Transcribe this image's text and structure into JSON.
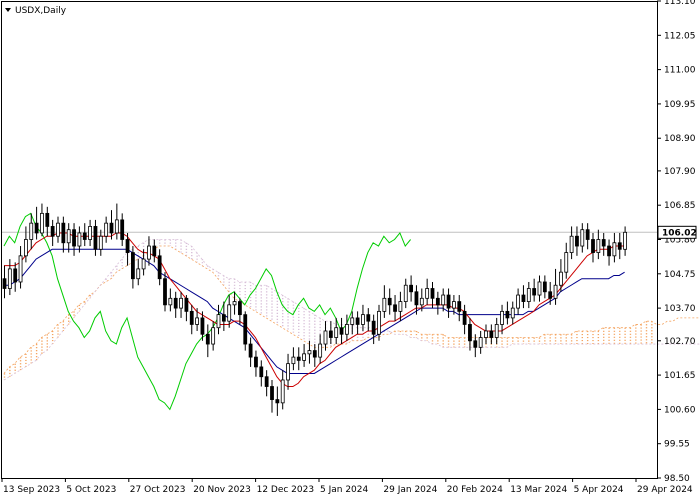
{
  "chart_data": {
    "type": "candlestick",
    "title": "USDX,Daily",
    "indicator": "Ichimoku Kinko Hyo",
    "ylim": [
      98.5,
      113.1
    ],
    "y_ticks": [
      "113.10",
      "112.05",
      "111.00",
      "109.95",
      "108.90",
      "107.90",
      "106.85",
      "105.80",
      "104.75",
      "103.70",
      "102.70",
      "101.65",
      "100.60",
      "99.55",
      "98.50"
    ],
    "x_ticks": [
      "13 Sep 2023",
      "5 Oct 2023",
      "27 Oct 2023",
      "20 Nov 2023",
      "12 Dec 2023",
      "5 Jan 2024",
      "29 Jan 2024",
      "20 Feb 2024",
      "13 Mar 2024",
      "5 Apr 2024",
      "29 Apr 2024"
    ],
    "last_price": "106.02",
    "last_price_value": 106.02,
    "colors": {
      "tenkan": "#cc0000",
      "kijun": "#00008b",
      "chikou": "#00cc00",
      "kumo_bull": "#f4a460",
      "kumo_bear": "#d8bfd8",
      "candle_body": "#000000",
      "axis": "#000000",
      "price_line": "#c0c0c0"
    },
    "ohlc": [
      [
        104.6,
        104.3,
        105.0,
        104.0
      ],
      [
        104.3,
        104.9,
        105.2,
        104.1
      ],
      [
        104.9,
        104.5,
        105.1,
        104.2
      ],
      [
        104.5,
        105.3,
        105.6,
        104.3
      ],
      [
        105.3,
        105.8,
        106.2,
        105.1
      ],
      [
        105.8,
        106.3,
        106.6,
        105.5
      ],
      [
        106.3,
        106.0,
        106.8,
        105.8
      ],
      [
        106.0,
        106.6,
        106.9,
        105.9
      ],
      [
        106.6,
        106.2,
        106.8,
        105.9
      ],
      [
        106.2,
        105.9,
        106.4,
        105.6
      ],
      [
        105.9,
        106.3,
        106.5,
        105.7
      ],
      [
        106.3,
        105.7,
        106.5,
        105.4
      ],
      [
        105.7,
        106.1,
        106.3,
        105.4
      ],
      [
        106.1,
        105.6,
        106.3,
        105.3
      ],
      [
        105.6,
        106.0,
        106.2,
        105.4
      ],
      [
        106.0,
        105.8,
        106.3,
        105.6
      ],
      [
        105.8,
        106.2,
        106.4,
        105.6
      ],
      [
        106.2,
        105.5,
        106.4,
        105.3
      ],
      [
        105.5,
        105.9,
        106.1,
        105.3
      ],
      [
        105.9,
        106.3,
        106.5,
        105.7
      ],
      [
        106.3,
        106.0,
        106.7,
        105.8
      ],
      [
        106.0,
        106.4,
        106.9,
        105.8
      ],
      [
        106.4,
        105.8,
        106.6,
        105.6
      ],
      [
        105.8,
        105.4,
        106.0,
        105.0
      ],
      [
        105.4,
        104.6,
        105.6,
        104.3
      ],
      [
        104.6,
        104.9,
        105.2,
        104.4
      ],
      [
        104.9,
        105.2,
        105.5,
        104.7
      ],
      [
        105.2,
        105.6,
        105.9,
        105.0
      ],
      [
        105.6,
        105.3,
        105.8,
        105.1
      ],
      [
        105.3,
        104.6,
        105.5,
        104.4
      ],
      [
        104.6,
        103.8,
        104.8,
        103.6
      ],
      [
        103.8,
        104.0,
        104.3,
        103.6
      ],
      [
        104.0,
        103.7,
        104.2,
        103.4
      ],
      [
        103.7,
        104.0,
        104.2,
        103.4
      ],
      [
        104.0,
        103.6,
        104.1,
        103.3
      ],
      [
        103.6,
        103.2,
        103.8,
        102.9
      ],
      [
        103.2,
        103.4,
        103.7,
        103.0
      ],
      [
        103.4,
        102.9,
        103.6,
        102.7
      ],
      [
        102.9,
        102.6,
        103.2,
        102.2
      ],
      [
        102.6,
        103.1,
        103.3,
        102.4
      ],
      [
        103.1,
        103.5,
        103.8,
        102.9
      ],
      [
        103.5,
        103.3,
        103.9,
        103.0
      ],
      [
        103.3,
        103.8,
        104.1,
        103.1
      ],
      [
        103.8,
        103.9,
        104.2,
        103.5
      ],
      [
        103.9,
        103.5,
        104.0,
        103.2
      ],
      [
        103.5,
        102.6,
        103.6,
        102.4
      ],
      [
        102.6,
        102.2,
        102.8,
        101.9
      ],
      [
        102.2,
        101.9,
        102.4,
        101.6
      ],
      [
        101.9,
        101.6,
        102.1,
        101.3
      ],
      [
        101.6,
        101.3,
        101.8,
        101.0
      ],
      [
        101.3,
        100.9,
        101.5,
        100.5
      ],
      [
        100.9,
        100.8,
        101.3,
        100.4
      ],
      [
        100.8,
        101.5,
        101.8,
        100.6
      ],
      [
        101.5,
        102.0,
        102.3,
        101.2
      ],
      [
        102.0,
        102.2,
        102.5,
        101.8
      ],
      [
        102.2,
        102.1,
        102.5,
        101.8
      ],
      [
        102.1,
        102.3,
        102.6,
        101.9
      ],
      [
        102.3,
        102.4,
        102.7,
        102.0
      ],
      [
        102.4,
        102.2,
        102.6,
        101.9
      ],
      [
        102.2,
        102.6,
        102.9,
        102.0
      ],
      [
        102.6,
        103.0,
        103.3,
        102.4
      ],
      [
        103.0,
        102.8,
        103.3,
        102.6
      ],
      [
        102.8,
        103.1,
        103.4,
        102.6
      ],
      [
        103.1,
        102.9,
        103.4,
        102.6
      ],
      [
        102.9,
        103.2,
        103.5,
        102.7
      ],
      [
        103.2,
        103.4,
        103.6,
        102.9
      ],
      [
        103.4,
        103.2,
        103.6,
        102.9
      ],
      [
        103.2,
        103.5,
        103.8,
        103.0
      ],
      [
        103.5,
        103.3,
        103.7,
        103.0
      ],
      [
        103.3,
        102.9,
        103.5,
        102.6
      ],
      [
        102.9,
        103.6,
        103.8,
        102.7
      ],
      [
        103.6,
        104.0,
        104.4,
        103.4
      ],
      [
        104.0,
        103.8,
        104.3,
        103.5
      ],
      [
        103.8,
        103.6,
        104.1,
        103.3
      ],
      [
        103.6,
        103.9,
        104.2,
        103.3
      ],
      [
        103.9,
        104.4,
        104.6,
        103.7
      ],
      [
        104.4,
        104.2,
        104.7,
        103.9
      ],
      [
        104.2,
        103.8,
        104.4,
        103.5
      ],
      [
        103.8,
        104.0,
        104.3,
        103.6
      ],
      [
        104.0,
        104.3,
        104.6,
        103.8
      ],
      [
        104.3,
        104.0,
        104.5,
        103.7
      ],
      [
        104.0,
        103.8,
        104.2,
        103.5
      ],
      [
        103.8,
        104.1,
        104.3,
        103.6
      ],
      [
        104.1,
        103.7,
        104.3,
        103.4
      ],
      [
        103.7,
        103.9,
        104.1,
        103.5
      ],
      [
        103.9,
        103.6,
        104.1,
        103.3
      ],
      [
        103.6,
        103.2,
        103.8,
        102.9
      ],
      [
        103.2,
        102.7,
        103.4,
        102.4
      ],
      [
        102.7,
        102.5,
        102.9,
        102.2
      ],
      [
        102.5,
        102.8,
        103.0,
        102.3
      ],
      [
        102.8,
        103.0,
        103.2,
        102.6
      ],
      [
        103.0,
        102.8,
        103.2,
        102.6
      ],
      [
        102.8,
        103.2,
        103.4,
        102.6
      ],
      [
        103.2,
        103.6,
        103.8,
        102.9
      ],
      [
        103.6,
        103.4,
        103.9,
        103.2
      ],
      [
        103.4,
        103.7,
        103.9,
        103.2
      ],
      [
        103.7,
        104.1,
        104.3,
        103.5
      ],
      [
        104.1,
        103.9,
        104.4,
        103.7
      ],
      [
        103.9,
        104.3,
        104.5,
        103.7
      ],
      [
        104.3,
        104.1,
        104.6,
        103.9
      ],
      [
        104.1,
        104.5,
        104.7,
        103.9
      ],
      [
        104.5,
        104.2,
        104.7,
        104.0
      ],
      [
        104.2,
        104.0,
        104.5,
        103.8
      ],
      [
        104.0,
        104.4,
        104.9,
        103.8
      ],
      [
        104.4,
        104.8,
        105.2,
        104.2
      ],
      [
        104.8,
        105.4,
        105.7,
        104.6
      ],
      [
        105.4,
        105.9,
        106.2,
        105.2
      ],
      [
        105.9,
        105.6,
        106.2,
        105.3
      ],
      [
        105.6,
        106.1,
        106.3,
        105.4
      ],
      [
        106.1,
        105.8,
        106.3,
        105.5
      ],
      [
        105.8,
        105.4,
        106.0,
        105.1
      ],
      [
        105.4,
        105.8,
        106.1,
        105.2
      ],
      [
        105.8,
        105.6,
        106.0,
        105.3
      ],
      [
        105.6,
        105.3,
        105.8,
        105.0
      ],
      [
        105.3,
        105.7,
        106.0,
        105.1
      ],
      [
        105.7,
        105.5,
        106.0,
        105.2
      ],
      [
        105.5,
        106.02,
        106.2,
        105.3
      ]
    ],
    "tenkan": [
      105.0,
      105.0,
      105.0,
      105.1,
      105.3,
      105.5,
      105.7,
      105.8,
      105.9,
      105.9,
      106.0,
      106.0,
      106.0,
      105.9,
      105.9,
      105.9,
      105.9,
      105.9,
      105.9,
      105.9,
      105.9,
      106.0,
      106.0,
      105.9,
      105.7,
      105.5,
      105.4,
      105.4,
      105.3,
      105.2,
      104.9,
      104.6,
      104.4,
      104.2,
      104.0,
      103.8,
      103.6,
      103.5,
      103.4,
      103.3,
      103.2,
      103.2,
      103.2,
      103.3,
      103.3,
      103.2,
      103.0,
      102.8,
      102.5,
      102.2,
      101.9,
      101.6,
      101.4,
      101.3,
      101.3,
      101.4,
      101.6,
      101.7,
      101.8,
      102.0,
      102.1,
      102.3,
      102.5,
      102.6,
      102.7,
      102.8,
      102.9,
      102.9,
      103.0,
      103.0,
      103.1,
      103.2,
      103.3,
      103.3,
      103.4,
      103.5,
      103.6,
      103.7,
      103.7,
      103.8,
      103.8,
      103.8,
      103.8,
      103.8,
      103.7,
      103.7,
      103.6,
      103.4,
      103.2,
      103.1,
      103.0,
      103.0,
      103.0,
      103.0,
      103.1,
      103.2,
      103.3,
      103.4,
      103.5,
      103.6,
      103.8,
      103.9,
      104.0,
      104.1,
      104.3,
      104.5,
      104.7,
      104.9,
      105.1,
      105.3,
      105.4,
      105.5,
      105.5,
      105.5,
      105.6,
      105.6,
      105.6
    ],
    "kijun": [
      104.4,
      104.4,
      104.5,
      104.6,
      104.8,
      105.0,
      105.2,
      105.3,
      105.4,
      105.5,
      105.5,
      105.5,
      105.5,
      105.5,
      105.5,
      105.5,
      105.5,
      105.5,
      105.5,
      105.5,
      105.5,
      105.5,
      105.5,
      105.5,
      105.4,
      105.3,
      105.2,
      105.1,
      105.0,
      104.8,
      104.7,
      104.6,
      104.5,
      104.4,
      104.3,
      104.2,
      104.1,
      104.0,
      103.9,
      103.7,
      103.6,
      103.5,
      103.4,
      103.3,
      103.2,
      103.1,
      102.9,
      102.7,
      102.5,
      102.3,
      102.1,
      101.9,
      101.8,
      101.7,
      101.7,
      101.7,
      101.7,
      101.7,
      101.7,
      101.8,
      101.9,
      102.0,
      102.1,
      102.2,
      102.3,
      102.4,
      102.5,
      102.6,
      102.7,
      102.8,
      102.9,
      103.0,
      103.1,
      103.2,
      103.3,
      103.4,
      103.5,
      103.6,
      103.7,
      103.7,
      103.7,
      103.7,
      103.7,
      103.6,
      103.6,
      103.5,
      103.5,
      103.5,
      103.5,
      103.5,
      103.5,
      103.5,
      103.5,
      103.5,
      103.5,
      103.5,
      103.5,
      103.5,
      103.6,
      103.6,
      103.7,
      103.8,
      103.9,
      104.0,
      104.2,
      104.3,
      104.4,
      104.5,
      104.6,
      104.6,
      104.6,
      104.6,
      104.6,
      104.6,
      104.7,
      104.7,
      104.8
    ],
    "chikou": [
      105.6,
      105.9,
      105.7,
      106.2,
      106.5,
      106.6,
      106.2,
      106.0,
      105.7,
      105.3,
      104.6,
      104.1,
      103.6,
      103.3,
      103.1,
      102.8,
      103.0,
      103.4,
      103.6,
      103.0,
      102.7,
      102.6,
      103.1,
      103.4,
      102.8,
      102.2,
      101.9,
      101.6,
      101.3,
      100.9,
      100.8,
      100.6,
      101.0,
      101.5,
      102.0,
      102.3,
      102.6,
      102.8,
      102.9,
      103.1,
      103.4,
      103.8,
      104.1,
      104.2,
      104.0,
      103.8,
      104.1,
      104.3,
      104.6,
      104.9,
      104.7,
      104.2,
      103.8,
      103.6,
      103.5,
      103.8,
      104.0,
      103.7,
      103.6,
      103.8,
      103.5,
      103.7,
      103.4,
      103.0,
      103.2,
      103.6,
      104.3,
      104.9,
      105.4,
      105.7,
      105.6,
      105.9,
      105.7,
      105.8,
      106.0,
      105.6,
      105.8
    ],
    "span_a": [
      101.7,
      101.9,
      102.0,
      102.2,
      102.3,
      102.5,
      102.6,
      102.8,
      102.9,
      103.0,
      103.2,
      103.3,
      103.5,
      103.6,
      103.8,
      103.9,
      104.1,
      104.2,
      104.4,
      104.5,
      104.6,
      104.8,
      104.9,
      105.0,
      105.1,
      105.2,
      105.3,
      105.4,
      105.5,
      105.6,
      105.6,
      105.6,
      105.5,
      105.4,
      105.3,
      105.2,
      105.1,
      105.0,
      104.9,
      104.8,
      104.6,
      104.4,
      104.2,
      104.0,
      103.9,
      103.8,
      103.7,
      103.6,
      103.5,
      103.4,
      103.3,
      103.2,
      103.1,
      103.0,
      102.9,
      102.8,
      102.7,
      102.6,
      102.5,
      102.5,
      102.5,
      102.5,
      102.6,
      102.6,
      102.6,
      102.7,
      102.7,
      102.7,
      102.8,
      102.8,
      102.8,
      102.9,
      102.9,
      103.0,
      103.0,
      103.0,
      103.0,
      103.0,
      102.9,
      102.9,
      102.9,
      102.9,
      102.9,
      102.8,
      102.8,
      102.8,
      102.8,
      102.8,
      102.8,
      102.8,
      102.8,
      102.8,
      102.8,
      102.8,
      102.8,
      102.8,
      102.8,
      102.8,
      102.8,
      102.8,
      102.8,
      102.9,
      102.9,
      102.9,
      102.9,
      102.9,
      102.9,
      103.0,
      103.0,
      103.0,
      103.0,
      103.0,
      103.1,
      103.1,
      103.1,
      103.1,
      103.1,
      103.1,
      103.2,
      103.2,
      103.3,
      103.3,
      103.2,
      103.2,
      103.3,
      103.3,
      103.4,
      103.4,
      103.4,
      103.4,
      103.4,
      103.4,
      103.4,
      103.4
    ],
    "span_b": [
      101.5,
      101.6,
      101.7,
      101.8,
      101.9,
      102.0,
      102.1,
      102.3,
      102.4,
      102.6,
      102.8,
      103.0,
      103.2,
      103.4,
      103.6,
      103.8,
      104.0,
      104.2,
      104.4,
      104.6,
      104.8,
      105.0,
      105.2,
      105.4,
      105.5,
      105.6,
      105.7,
      105.8,
      105.8,
      105.8,
      105.8,
      105.8,
      105.8,
      105.8,
      105.7,
      105.6,
      105.4,
      105.2,
      105.0,
      104.9,
      104.8,
      104.7,
      104.6,
      104.6,
      104.5,
      104.5,
      104.5,
      104.4,
      104.4,
      104.4,
      104.3,
      104.2,
      104.1,
      104.0,
      103.9,
      103.8,
      103.7,
      103.6,
      103.5,
      103.4,
      103.3,
      103.3,
      103.2,
      103.2,
      103.2,
      103.2,
      103.1,
      103.1,
      103.1,
      103.1,
      103.0,
      103.0,
      103.0,
      102.9,
      102.9,
      102.9,
      102.8,
      102.8,
      102.7,
      102.7,
      102.6,
      102.6,
      102.5,
      102.5,
      102.5,
      102.5,
      102.5,
      102.5,
      102.5,
      102.5,
      102.5,
      102.5,
      102.5,
      102.5,
      102.5,
      102.6,
      102.6,
      102.6,
      102.6,
      102.6,
      102.6,
      102.6,
      102.6,
      102.6,
      102.6,
      102.6,
      102.6,
      102.6,
      102.6,
      102.6,
      102.6,
      102.6,
      102.6,
      102.6,
      102.6,
      102.6,
      102.6,
      102.6,
      102.6,
      102.6,
      102.6,
      102.6,
      102.6,
      102.6,
      102.6,
      102.6,
      102.6,
      102.6,
      102.6,
      102.6,
      102.6,
      102.6,
      102.6,
      102.6
    ]
  }
}
